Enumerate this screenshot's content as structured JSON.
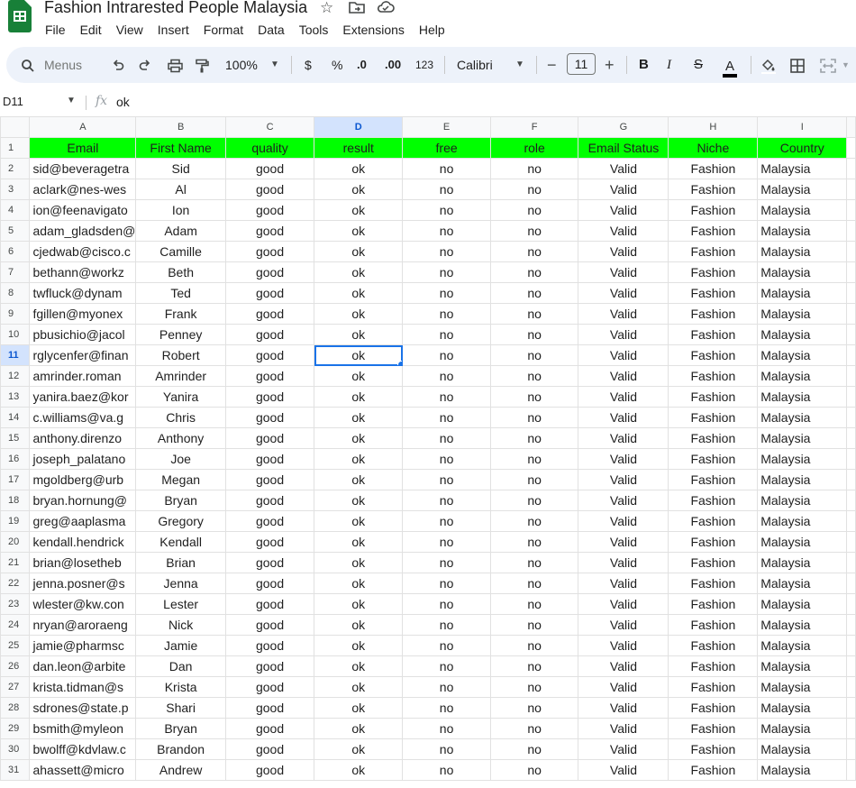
{
  "app": {
    "doc_title": "Fashion Intrarested People Malaysia",
    "title_icons": [
      "star-icon",
      "move-to-folder-icon",
      "cloud-saved-icon"
    ],
    "brand_color": "#188038"
  },
  "menu": [
    "File",
    "Edit",
    "View",
    "Insert",
    "Format",
    "Data",
    "Tools",
    "Extensions",
    "Help"
  ],
  "toolbar": {
    "search_label": "Menus",
    "zoom": "100%",
    "currency": "$",
    "percent": "%",
    "decrease_decimal": ".0",
    "increase_decimal": ".00",
    "number_format": "123",
    "font": "Calibri",
    "font_size": "11",
    "minus": "−",
    "plus": "+",
    "bold": "B",
    "italic": "I",
    "strike": "S",
    "text_color": "A"
  },
  "formula_bar": {
    "cell_ref": "D11",
    "fx": "fx",
    "value": "ok"
  },
  "columns": [
    "A",
    "B",
    "C",
    "D",
    "E",
    "F",
    "G",
    "H",
    "I"
  ],
  "selected_column": "D",
  "selected_row": "11",
  "header_fill": "#00ff00",
  "sheet": {
    "header_row": [
      "Email",
      "First Name",
      "quality",
      "result",
      "free",
      "role",
      "Email Status",
      "Niche",
      "Country"
    ],
    "rows": [
      {
        "n": "2",
        "email": "sid@beveragetra",
        "first": "Sid"
      },
      {
        "n": "3",
        "email": "aclark@nes-wes",
        "first": "Al"
      },
      {
        "n": "4",
        "email": "ion@feenavigato",
        "first": "Ion"
      },
      {
        "n": "5",
        "email": "adam_gladsden@",
        "first": "Adam"
      },
      {
        "n": "6",
        "email": "cjedwab@cisco.c",
        "first": "Camille"
      },
      {
        "n": "7",
        "email": "bethann@workz",
        "first": "Beth"
      },
      {
        "n": "8",
        "email": "twfluck@dynam",
        "first": "Ted"
      },
      {
        "n": "9",
        "email": "fgillen@myonex",
        "first": "Frank"
      },
      {
        "n": "10",
        "email": "pbusichio@jacol",
        "first": "Penney"
      },
      {
        "n": "11",
        "email": "rglycenfer@finan",
        "first": "Robert"
      },
      {
        "n": "12",
        "email": "amrinder.roman",
        "first": "Amrinder"
      },
      {
        "n": "13",
        "email": "yanira.baez@kor",
        "first": "Yanira"
      },
      {
        "n": "14",
        "email": "c.williams@va.g",
        "first": "Chris"
      },
      {
        "n": "15",
        "email": "anthony.direnzo",
        "first": "Anthony"
      },
      {
        "n": "16",
        "email": "joseph_palatano",
        "first": "Joe"
      },
      {
        "n": "17",
        "email": "mgoldberg@urb",
        "first": "Megan"
      },
      {
        "n": "18",
        "email": "bryan.hornung@",
        "first": "Bryan"
      },
      {
        "n": "19",
        "email": "greg@aaplasma",
        "first": "Gregory"
      },
      {
        "n": "20",
        "email": "kendall.hendrick",
        "first": "Kendall"
      },
      {
        "n": "21",
        "email": "brian@losetheb",
        "first": "Brian"
      },
      {
        "n": "22",
        "email": "jenna.posner@s",
        "first": "Jenna"
      },
      {
        "n": "23",
        "email": "wlester@kw.con",
        "first": "Lester"
      },
      {
        "n": "24",
        "email": "nryan@aroraeng",
        "first": "Nick"
      },
      {
        "n": "25",
        "email": "jamie@pharmsc",
        "first": "Jamie"
      },
      {
        "n": "26",
        "email": "dan.leon@arbite",
        "first": "Dan"
      },
      {
        "n": "27",
        "email": "krista.tidman@s",
        "first": "Krista"
      },
      {
        "n": "28",
        "email": "sdrones@state.p",
        "first": "Shari"
      },
      {
        "n": "29",
        "email": "bsmith@myleon",
        "first": "Bryan"
      },
      {
        "n": "30",
        "email": "bwolff@kdvlaw.c",
        "first": "Brandon"
      },
      {
        "n": "31",
        "email": "ahassett@micro",
        "first": "Andrew"
      }
    ],
    "row_constants": {
      "quality": "good",
      "result": "ok",
      "free": "no",
      "role": "no",
      "status": "Valid",
      "niche": "Fashion",
      "country": "Malaysia"
    }
  }
}
